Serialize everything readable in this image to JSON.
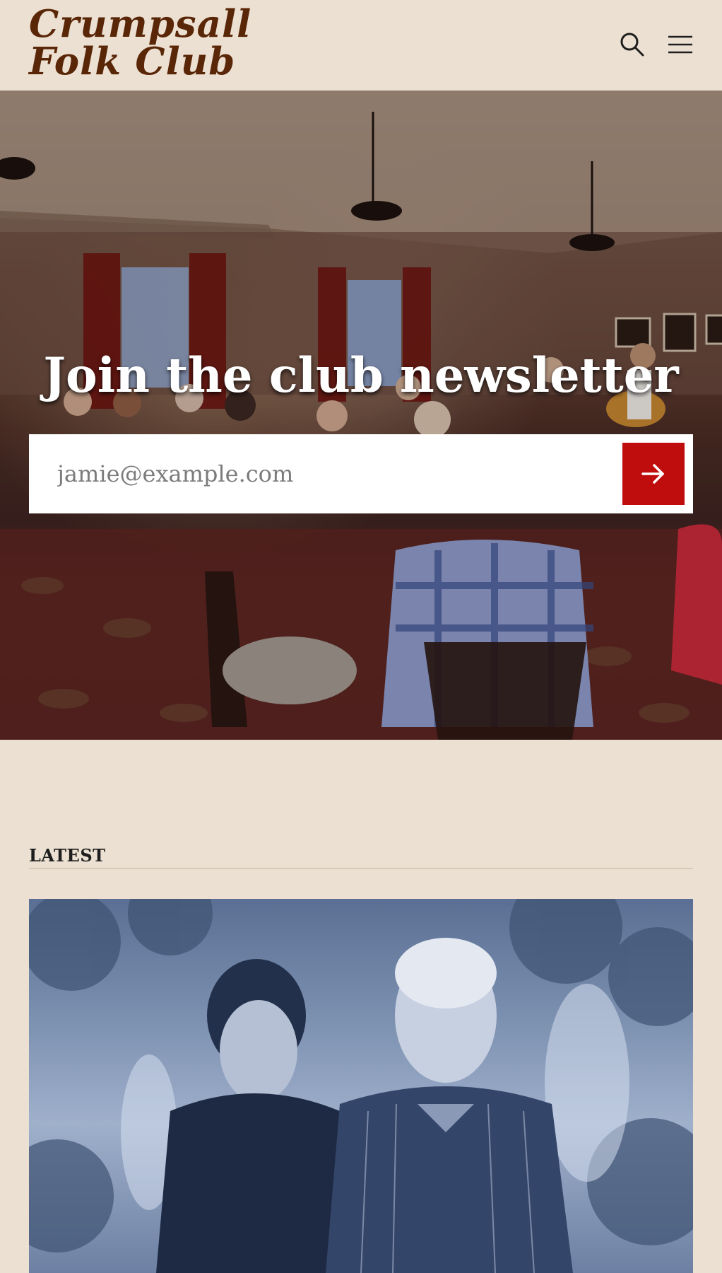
{
  "site": {
    "logo_line1": "Crumpsall",
    "logo_line2": "Folk Club"
  },
  "header": {
    "search_icon": "search-icon",
    "menu_icon": "hamburger-menu-icon"
  },
  "hero": {
    "title": "Join the club newsletter",
    "email_placeholder": "jamie@example.com",
    "submit_icon": "arrow-right-icon"
  },
  "latest": {
    "label": "LATEST"
  },
  "colors": {
    "background": "#ebe0d1",
    "logo": "#5a2608",
    "accent": "#bf0d0d",
    "text": "#1e1e1e"
  }
}
